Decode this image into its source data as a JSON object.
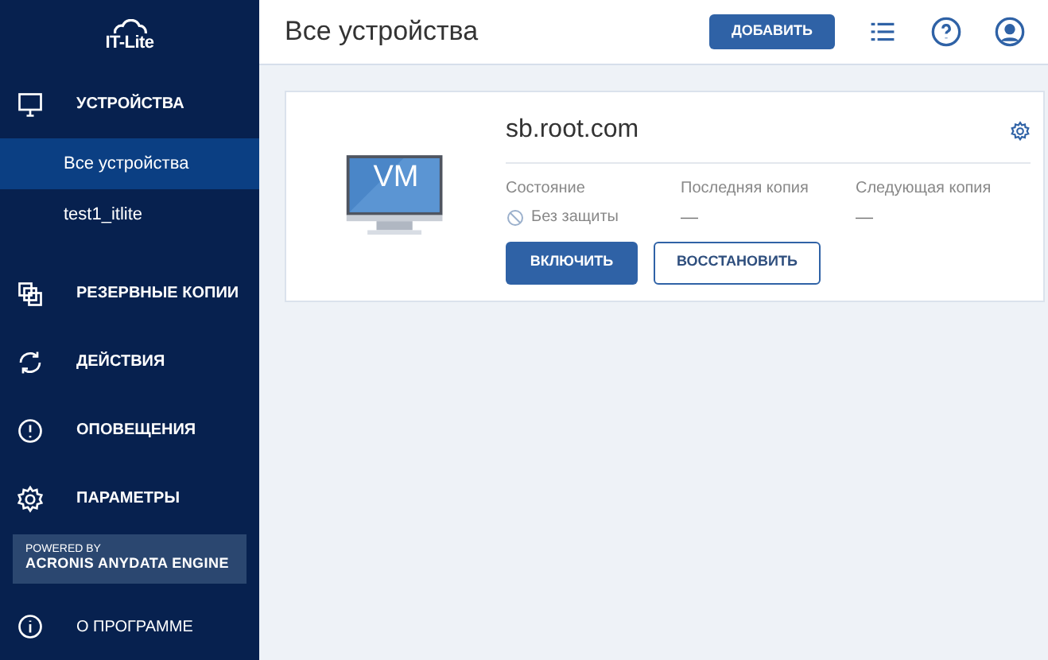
{
  "logo": {
    "text": "IT-Lite"
  },
  "sidebar": {
    "items": [
      {
        "kind": "section",
        "label": "УСТРОЙСТВА",
        "selected": false
      },
      {
        "kind": "sub",
        "label": "Все устройства",
        "selected": true
      },
      {
        "kind": "sub",
        "label": "test1_itlite",
        "selected": false
      },
      {
        "kind": "section",
        "label": "РЕЗЕРВНЫЕ КОПИИ",
        "selected": false
      },
      {
        "kind": "section",
        "label": "ДЕЙСТВИЯ",
        "selected": false
      },
      {
        "kind": "section",
        "label": "ОПОВЕЩЕНИЯ",
        "selected": false
      },
      {
        "kind": "section",
        "label": "ПАРАМЕТРЫ",
        "selected": false
      }
    ],
    "powered": {
      "line1": "POWERED BY",
      "line2": "ACRONIS ANYDATA ENGINE"
    },
    "about": {
      "label": "О ПРОГРАММЕ"
    }
  },
  "header": {
    "title": "Все устройства",
    "add_button": "ДОБАВИТЬ"
  },
  "device": {
    "badge": "VM",
    "name": "sb.root.com",
    "fields": [
      {
        "label": "Состояние",
        "value": "Без защиты",
        "kind": "status"
      },
      {
        "label": "Последняя копия",
        "value": "—",
        "kind": "plain"
      },
      {
        "label": "Следующая копия",
        "value": "—",
        "kind": "plain"
      }
    ],
    "primary_button": "ВКЛЮЧИТЬ",
    "secondary_button": "ВОССТАНОВИТЬ"
  }
}
